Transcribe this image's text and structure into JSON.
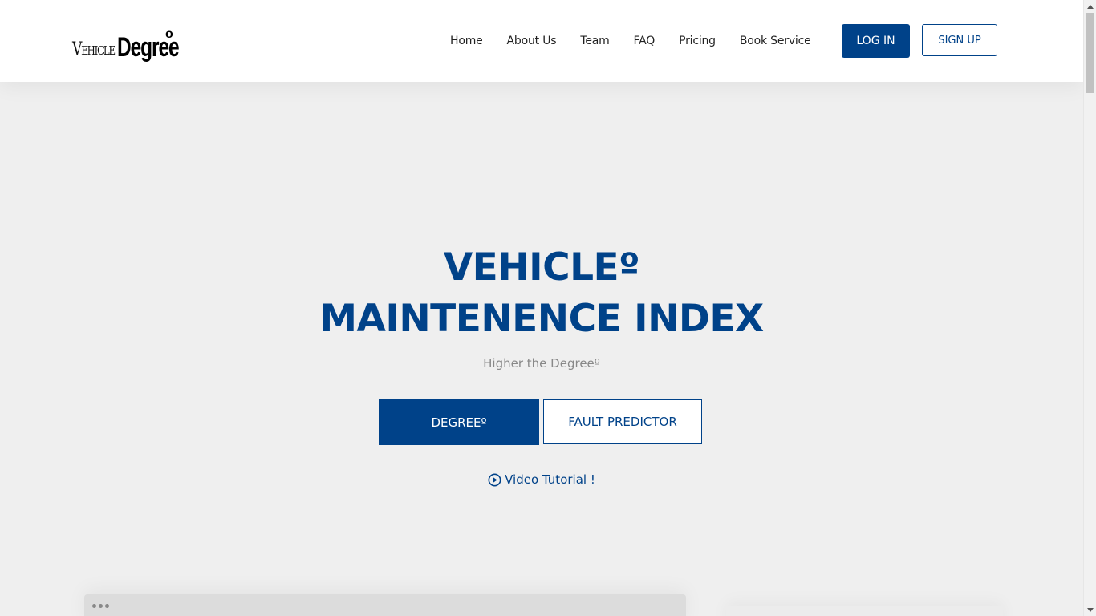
{
  "header": {
    "logo": {
      "part1": "Vehicle",
      "part2": "Degree",
      "degree_mark": "o"
    },
    "nav": [
      {
        "label": "Home"
      },
      {
        "label": "About Us"
      },
      {
        "label": "Team"
      },
      {
        "label": "FAQ"
      },
      {
        "label": "Pricing"
      },
      {
        "label": "Book Service"
      }
    ],
    "login_label": "LOG IN",
    "signup_label": "SIGN UP"
  },
  "hero": {
    "title_line1": "VEHICLEº",
    "title_line2": "MAINTENENCE INDEX",
    "subtitle": "Higher the Degreeº",
    "primary_button": "DEGREEº",
    "secondary_button": "FAULT PREDICTOR",
    "video_link": "Video Tutorial !"
  },
  "icons": {
    "video": "play-circle-icon",
    "preview_dots": "more-dots-icon"
  },
  "colors": {
    "brand": "#004289",
    "background": "#efefef",
    "header_bg": "#ffffff",
    "subtitle": "#888888"
  }
}
